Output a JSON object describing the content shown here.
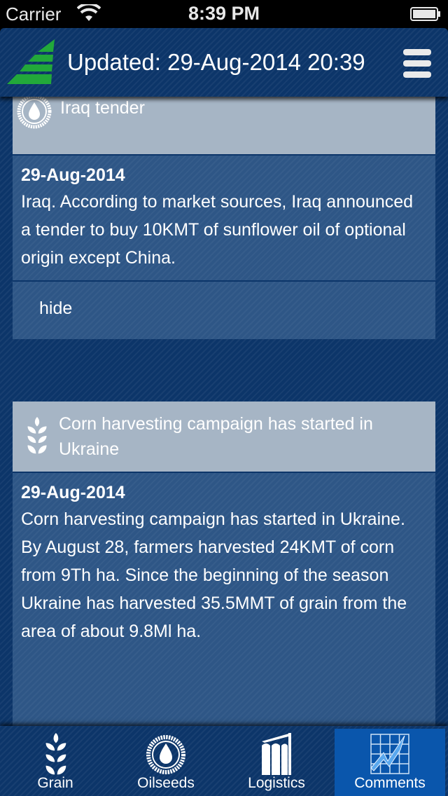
{
  "status_bar": {
    "carrier": "Carrier",
    "time": "8:39 PM",
    "wifi_icon": "wifi-icon",
    "battery_icon": "battery-icon"
  },
  "header": {
    "title": "Updated: 29-Aug-2014 20:39",
    "logo_icon": "logo-green-sail-icon",
    "menu_icon": "hamburger-menu-icon",
    "brand_color": "#22a83a"
  },
  "news": [
    {
      "icon": "oil-drop-icon",
      "title": "Iraq tender",
      "date": "29-Aug-2014",
      "text": "Iraq. According to market sources, Iraq announced a tender to buy 10KMT of sunflower oil of optional origin except China.",
      "hide_label": "hide"
    },
    {
      "icon": "wheat-icon",
      "title": "Corn harvesting campaign has started in Ukraine",
      "date": "29-Aug-2014",
      "text": "Corn harvesting campaign has started in Ukraine. By August 28, farmers harvested 24KMT of corn from 9Th ha. Since the beginning of the season Ukraine has harvested 35.5MMT of grain from the area of about 9.8Ml ha."
    }
  ],
  "tabs": [
    {
      "label": "Grain",
      "icon": "wheat-icon",
      "active": false
    },
    {
      "label": "Oilseeds",
      "icon": "oil-drop-icon",
      "active": false
    },
    {
      "label": "Logistics",
      "icon": "silo-icon",
      "active": false
    },
    {
      "label": "Comments",
      "icon": "chart-grid-icon",
      "active": true
    }
  ],
  "colors": {
    "background": "#0c3569",
    "card_header": "#a6b5c5",
    "card_body": "#2e5686",
    "active_tab": "#0a56ac"
  }
}
